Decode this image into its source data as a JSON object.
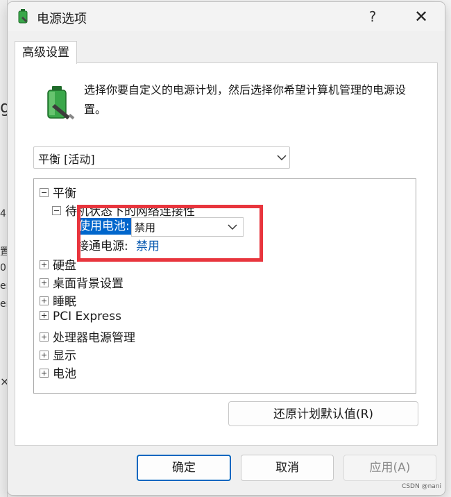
{
  "background_fragments": [
    "g",
    "4",
    "置",
    "0",
    "er",
    "er",
    "×"
  ],
  "dialog": {
    "title": "电源选项",
    "help_label": "?",
    "close_label": "✕"
  },
  "tab": {
    "label": "高级设置"
  },
  "intro_text": "选择你要自定义的电源计划，然后选择你希望计算机管理的电源设置。",
  "plan_select": {
    "value": "平衡 [活动]"
  },
  "tree": {
    "root": "平衡",
    "child": "待机状态下的网络连接性",
    "on_battery_label": "使用电池:",
    "on_battery_value": "禁用",
    "plugged_in_label": "接通电源:",
    "plugged_in_value": "禁用",
    "items": [
      "硬盘",
      "桌面背景设置",
      "睡眠",
      "PCI Express",
      "处理器电源管理",
      "显示",
      "电池"
    ]
  },
  "restore_button": "还原计划默认值(R)",
  "footer": {
    "ok": "确定",
    "cancel": "取消",
    "apply": "应用(A)"
  },
  "watermark": "CSDN @nani",
  "colors": {
    "accent": "#0067c0",
    "selection": "#0066cc",
    "link_value": "#0a5ab0",
    "highlight_box": "#e8353d"
  }
}
